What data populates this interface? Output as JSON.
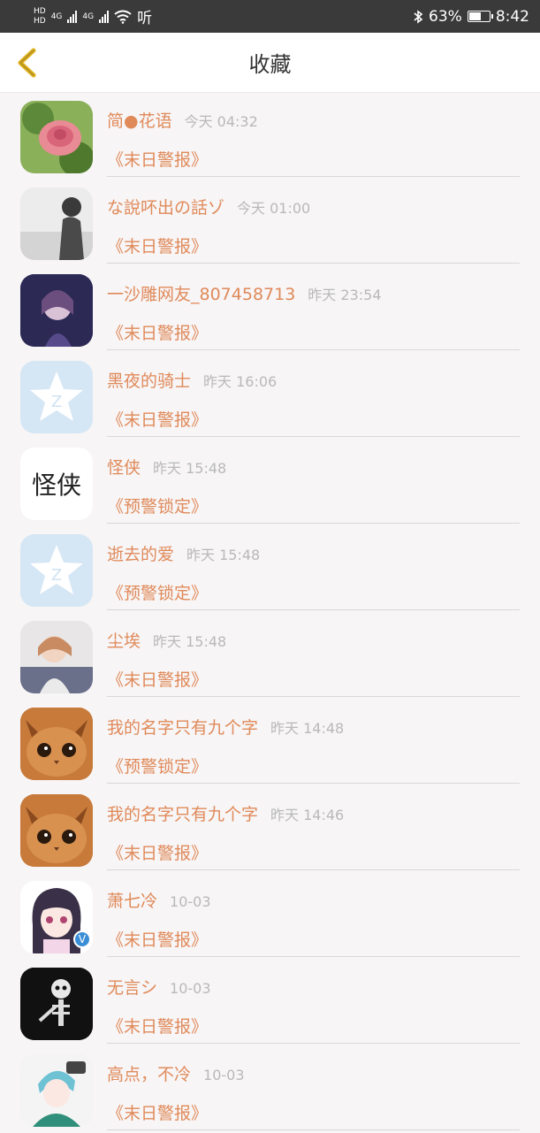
{
  "status_bar": {
    "network_1": "4G",
    "network_2": "4G",
    "ting": "听",
    "battery_percent": "63%",
    "battery_level": 0.63,
    "time": "8:42"
  },
  "header": {
    "title": "收藏"
  },
  "items": [
    {
      "name": "简●花语",
      "time": "今天 04:32",
      "tag": "《末日警报》",
      "avatar": "rose"
    },
    {
      "name": "な說吥出の話ゾ",
      "time": "今天 01:00",
      "tag": "《末日警报》",
      "avatar": "bw-person"
    },
    {
      "name": "一沙雕网友_807458713",
      "time": "昨天 23:54",
      "tag": "《末日警报》",
      "avatar": "anime-night"
    },
    {
      "name": "黑夜的骑士",
      "time": "昨天 16:06",
      "tag": "《末日警报》",
      "avatar": "qq-star"
    },
    {
      "name": "怪侠",
      "time": "昨天 15:48",
      "tag": "《预警锁定》",
      "avatar": "calligraphy",
      "avatar_text": "怪侠"
    },
    {
      "name": "逝去的爱",
      "time": "昨天 15:48",
      "tag": "《预警锁定》",
      "avatar": "qq-star"
    },
    {
      "name": "尘埃",
      "time": "昨天 15:48",
      "tag": "《末日警报》",
      "avatar": "girl-photo"
    },
    {
      "name": "我的名字只有九个字",
      "time": "昨天 14:48",
      "tag": "《预警锁定》",
      "avatar": "cat"
    },
    {
      "name": "我的名字只有九个字",
      "time": "昨天 14:46",
      "tag": "《末日警报》",
      "avatar": "cat"
    },
    {
      "name": "萧七冷",
      "time": "10-03",
      "tag": "《末日警报》",
      "avatar": "anime-girl",
      "verified": "V"
    },
    {
      "name": "无言シ",
      "time": "10-03",
      "tag": "《末日警报》",
      "avatar": "skeleton"
    },
    {
      "name": "高点，不冷",
      "time": "10-03",
      "tag": "《末日警报》",
      "avatar": "anime-boy"
    }
  ],
  "colors": {
    "accent": "#e08a5a",
    "back_icon": "#e0b21e",
    "time_gray": "#b9b9b9",
    "status_bar": "#3a3a3a"
  }
}
